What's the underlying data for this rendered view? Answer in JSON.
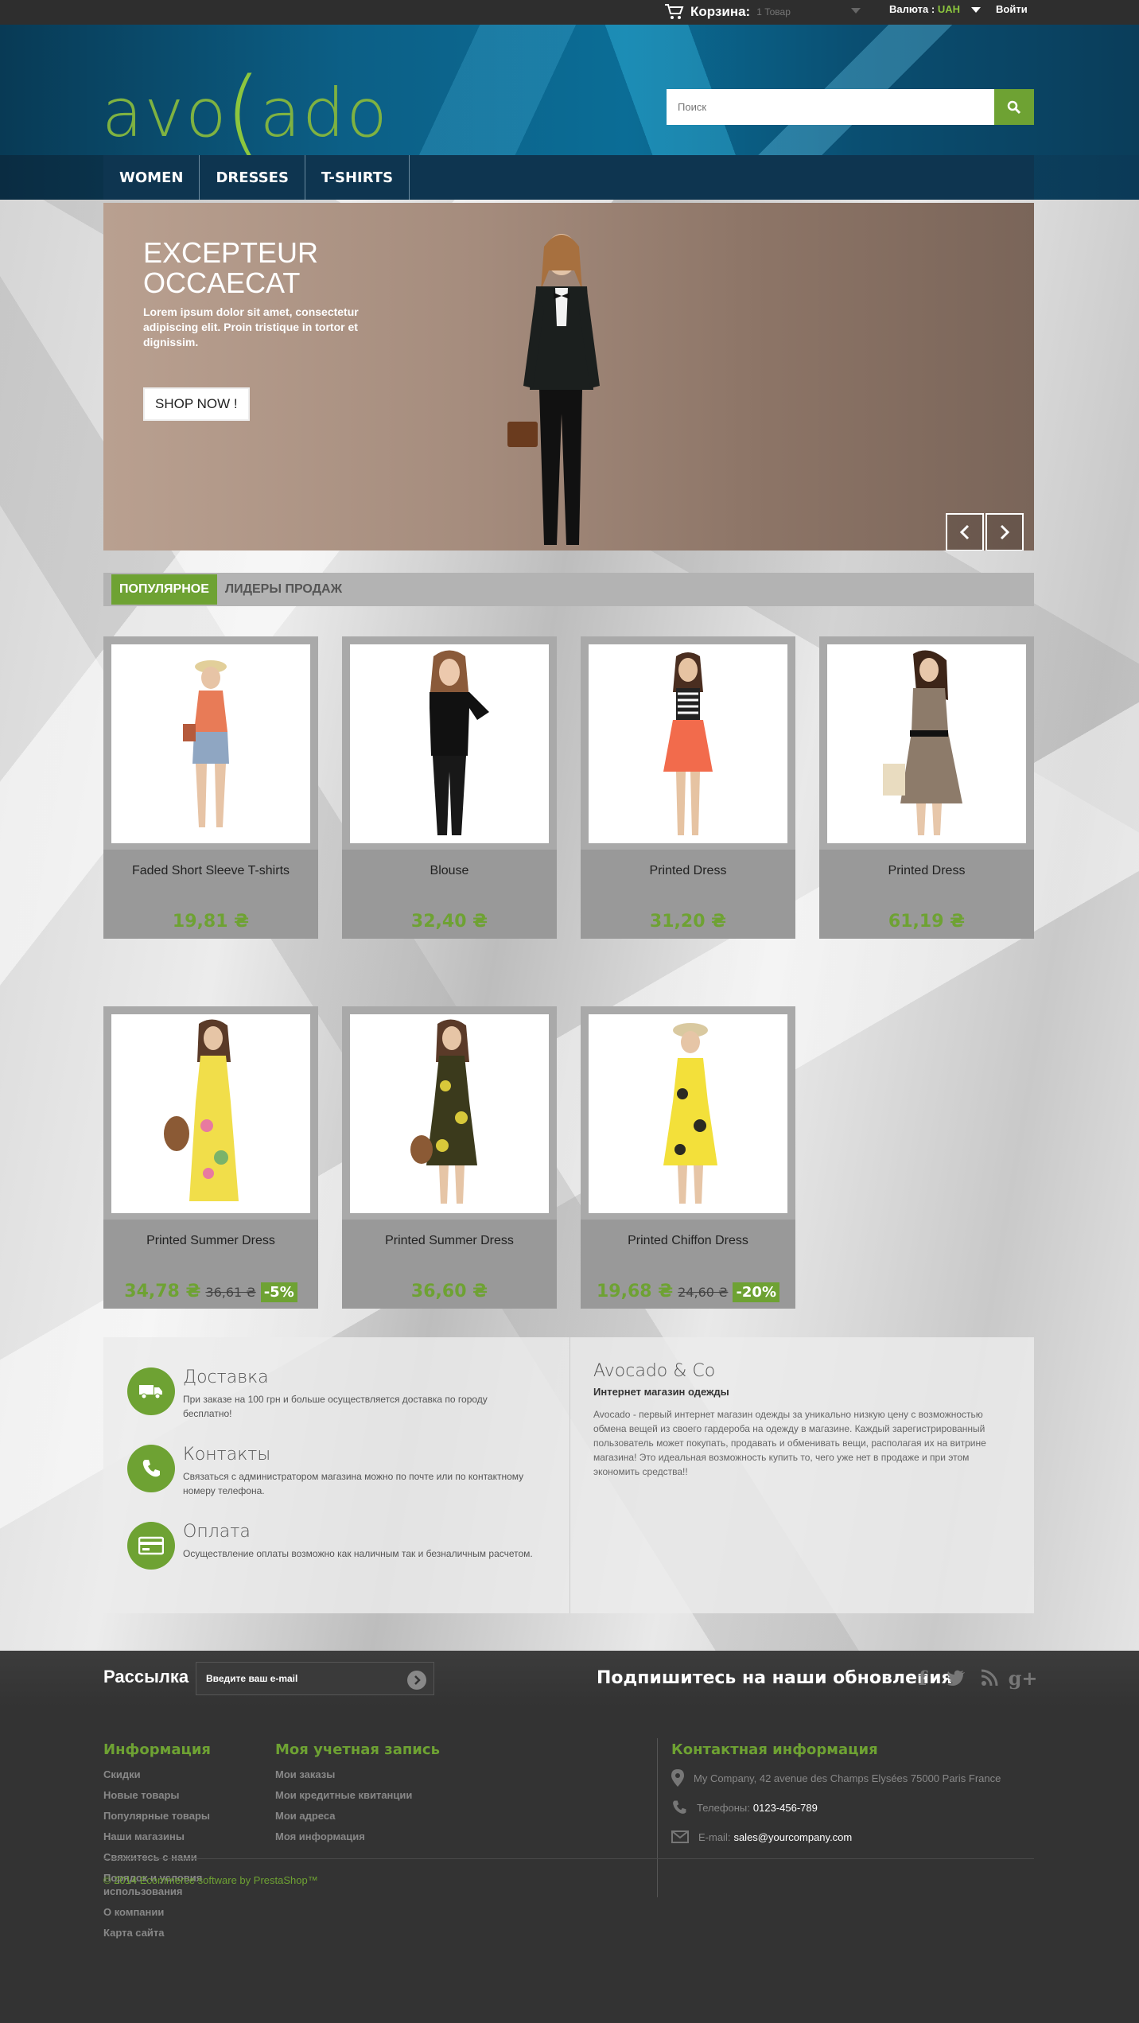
{
  "topbar": {
    "cart_label": "Корзина:",
    "cart_count": "1 Товар",
    "currency_label": "Валюта :",
    "currency_value": "UAH",
    "login": "Войти"
  },
  "header": {
    "logo_pre": "avo",
    "logo_c": "(",
    "logo_post": "ado",
    "search_placeholder": "Поиск"
  },
  "nav": {
    "items": [
      "WOMEN",
      "DRESSES",
      "T-SHIRTS"
    ]
  },
  "slider": {
    "title": "EXCEPTEUR OCCAECAT",
    "text": "Lorem ipsum dolor sit amet, consectetur adipiscing elit. Proin tristique in tortor et dignissim.",
    "button": "SHOP NOW !"
  },
  "tabs": {
    "popular": "ПОПУЛЯРНОЕ",
    "bestsellers": "ЛИДЕРЫ ПРОДАЖ"
  },
  "products": [
    {
      "name": "Faded Short Sleeve T-shirts",
      "price": "19,81 ₴",
      "old_price": "",
      "discount": ""
    },
    {
      "name": "Blouse",
      "price": "32,40 ₴",
      "old_price": "",
      "discount": ""
    },
    {
      "name": "Printed Dress",
      "price": "31,20 ₴",
      "old_price": "",
      "discount": ""
    },
    {
      "name": "Printed Dress",
      "price": "61,19 ₴",
      "old_price": "",
      "discount": ""
    },
    {
      "name": "Printed Summer Dress",
      "price": "34,78 ₴",
      "old_price": "36,61 ₴",
      "discount": "-5%"
    },
    {
      "name": "Printed Summer Dress",
      "price": "36,60 ₴",
      "old_price": "",
      "discount": ""
    },
    {
      "name": "Printed Chiffon Dress",
      "price": "19,68 ₴",
      "old_price": "24,60 ₴",
      "discount": "-20%"
    }
  ],
  "features": {
    "delivery_title": "Доставка",
    "delivery_text": "При заказе на 100 грн и больше осуществляется доставка по городу бесплатно!",
    "contacts_title": "Контакты",
    "contacts_text": "Связаться с администратором магазина можно по почте или по контактному номеру телефона.",
    "payment_title": "Оплата",
    "payment_text": "Осуществление оплаты возможно как наличным так и безналичным расчетом."
  },
  "about": {
    "title": "Avocado & Co",
    "subtitle": "Интернет магазин одежды",
    "text": "Avocado - первый интернет магазин одежды за уникально низкую цену с возможностью обмена вещей из своего гардероба на одежду в магазине. Каждый зарегистрированный пользователь может покупать, продавать и обменивать вещи, располагая их на витрине магазина! Это идеальная возможность купить то, чего уже нет в продаже и при этом экономить средства!!"
  },
  "newsletter": {
    "title": "Рассылка",
    "placeholder": "Введите ваш e-mail",
    "subscribe": "Подпишитесь на наши обновления"
  },
  "social_icons": [
    "facebook-icon",
    "twitter-icon",
    "rss-icon",
    "google-plus-icon"
  ],
  "footer": {
    "info_title": "Информация",
    "info_links": [
      "Скидки",
      "Новые товары",
      "Популярные товары",
      "Наши магазины",
      "Свяжитесь с нами",
      "Порядок и условия использования",
      "О компании",
      "Карта сайта"
    ],
    "account_title": "Моя учетная запись",
    "account_links": [
      "Мои заказы",
      "Мои кредитные квитанции",
      "Мои адреса",
      "Моя информация"
    ],
    "contact_title": "Контактная информация",
    "address": "My Company, 42 avenue des Champs Elysées 75000 Paris France",
    "phone_label": "Телефоны:",
    "phone": "0123-456-789",
    "email_label": "E-mail:",
    "email": "sales@yourcompany.com",
    "copyright": "© 2014 Ecommerce software by PrestaShop™"
  },
  "colors": {
    "accent": "#6ea233",
    "header_blue": "#0c5f86",
    "dark": "#333333"
  }
}
